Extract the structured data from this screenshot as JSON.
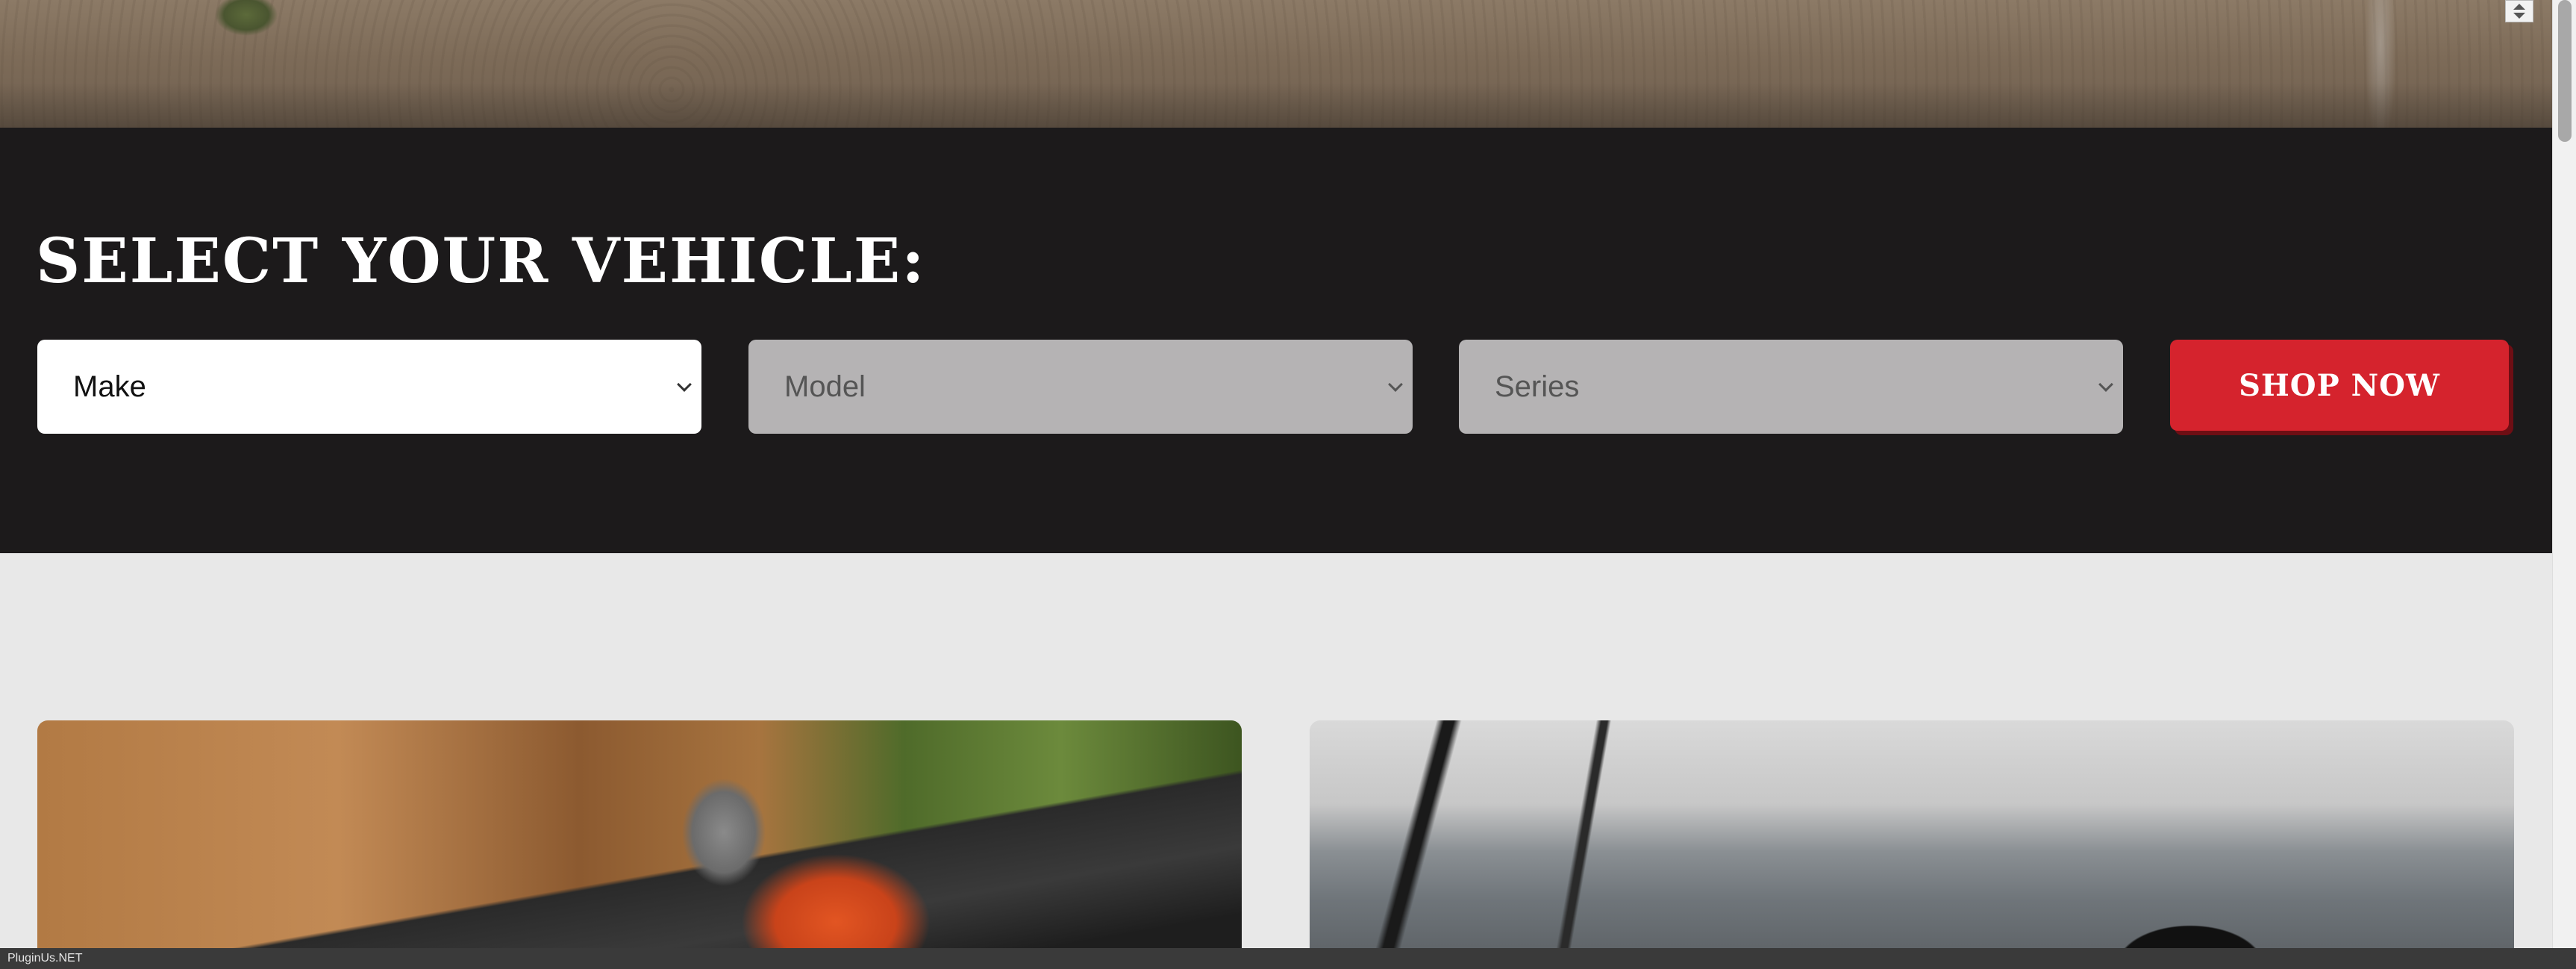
{
  "vehicle_selector": {
    "title": "SELECT YOUR VEHICLE:",
    "make_label": "Make",
    "model_label": "Model",
    "series_label": "Series",
    "shop_button_label": "SHOP NOW"
  },
  "footer": {
    "text": "PluginUs.NET"
  },
  "colors": {
    "band_background": "#1c1a1b",
    "page_background": "#e8e8e8",
    "shop_button": "#d5232d",
    "disabled_select": "#b5b3b4"
  },
  "icons": {
    "select_chevron": "chevron-down-icon",
    "corner_control": "up-down-arrow-icon"
  }
}
